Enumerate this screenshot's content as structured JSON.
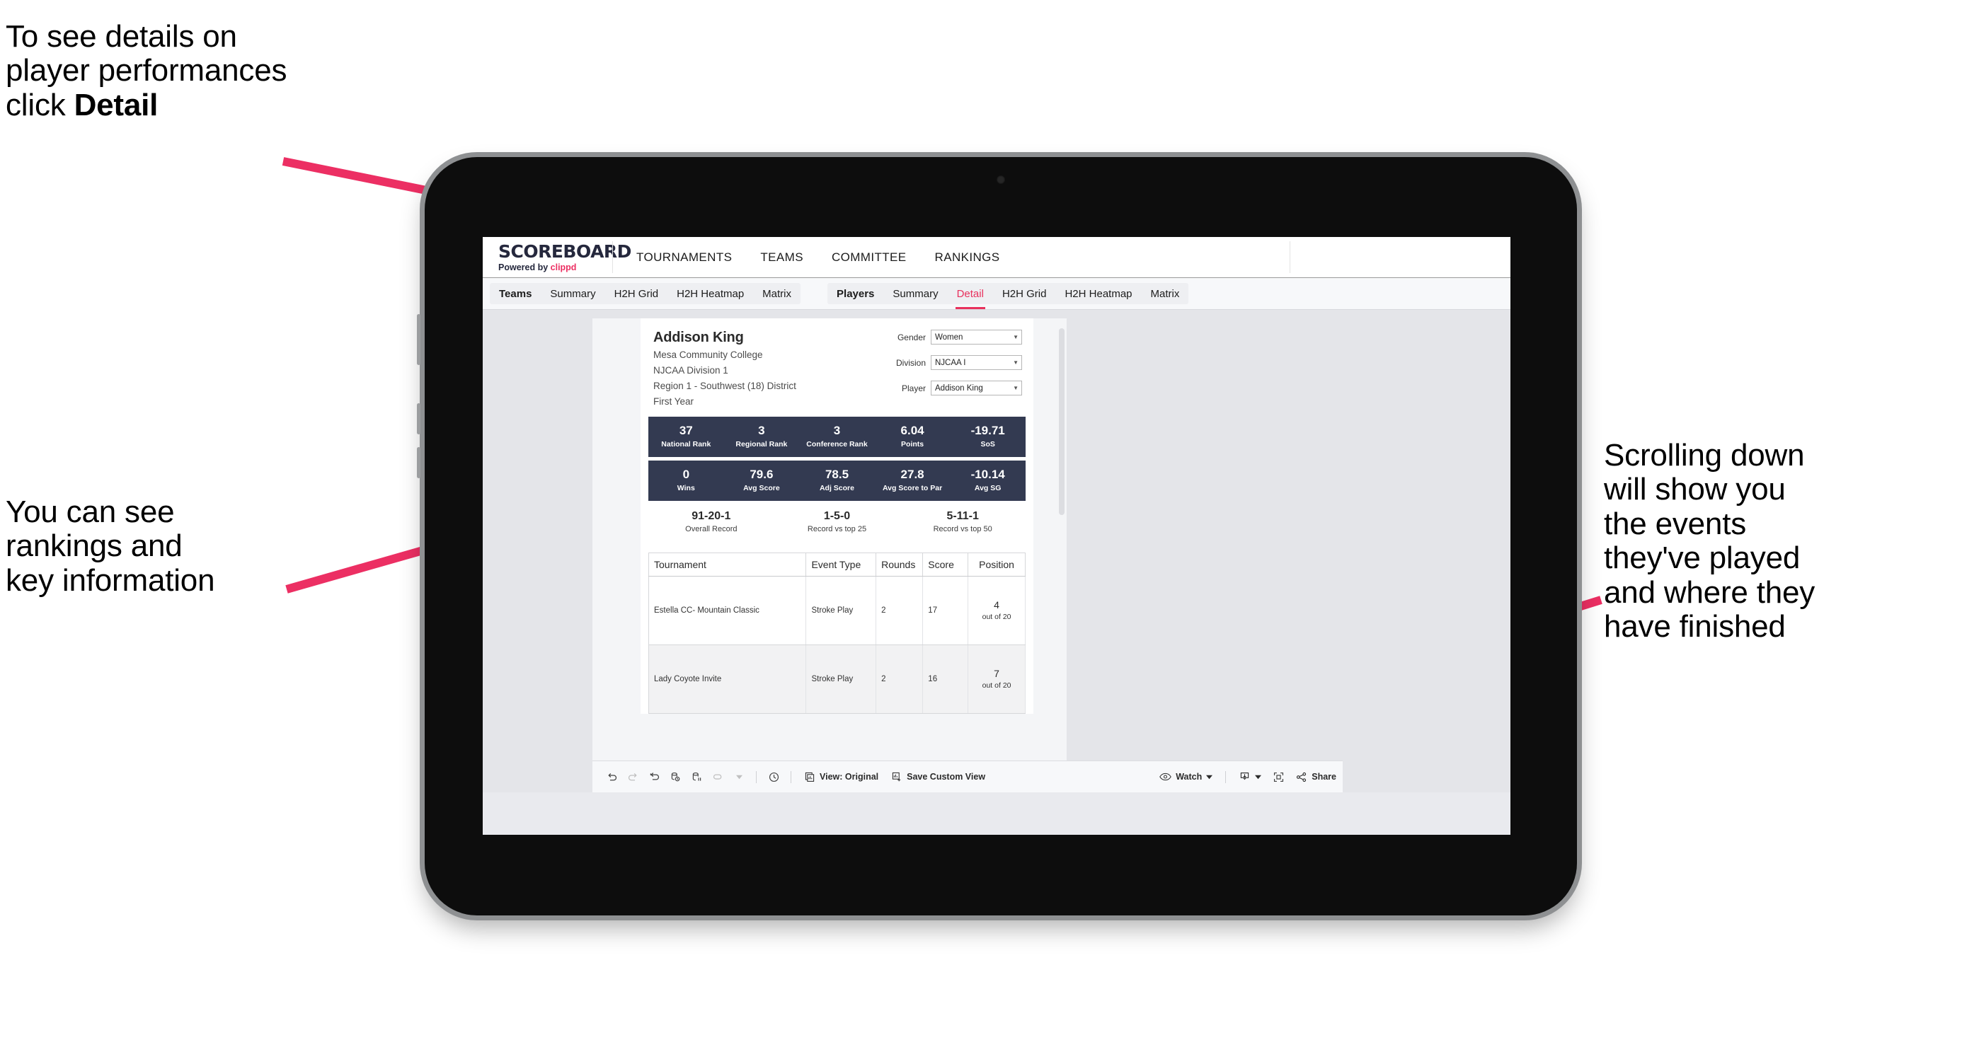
{
  "callouts": {
    "detail_line1": "To see details on\nplayer performances\nclick ",
    "detail_bold": "Detail",
    "rankings": "You can see\nrankings and\nkey information",
    "scrolling": "Scrolling down\nwill show you\nthe events\nthey've played\nand where they\nhave finished"
  },
  "app": {
    "brand": {
      "name": "SCOREBOARD",
      "powered_prefix": "Powered by ",
      "powered_accent": "clippd"
    },
    "top_nav": [
      "TOURNAMENTS",
      "TEAMS",
      "COMMITTEE",
      "RANKINGS"
    ],
    "tab_group_teams": [
      "Teams",
      "Summary",
      "H2H Grid",
      "H2H Heatmap",
      "Matrix"
    ],
    "tab_group_players": [
      "Players",
      "Summary",
      "Detail",
      "H2H Grid",
      "H2H Heatmap",
      "Matrix"
    ],
    "active_tab": "Detail"
  },
  "player": {
    "name": "Addison King",
    "college": "Mesa Community College",
    "division": "NJCAA Division 1",
    "region": "Region 1 - Southwest (18) District",
    "year": "First Year"
  },
  "filters": [
    {
      "label": "Gender",
      "value": "Women"
    },
    {
      "label": "Division",
      "value": "NJCAA I"
    },
    {
      "label": "Player",
      "value": "Addison King"
    }
  ],
  "stats_row_1": [
    {
      "value": "37",
      "label": "National Rank"
    },
    {
      "value": "3",
      "label": "Regional Rank"
    },
    {
      "value": "3",
      "label": "Conference Rank"
    },
    {
      "value": "6.04",
      "label": "Points"
    },
    {
      "value": "-19.71",
      "label": "SoS"
    }
  ],
  "stats_row_2": [
    {
      "value": "0",
      "label": "Wins"
    },
    {
      "value": "79.6",
      "label": "Avg Score"
    },
    {
      "value": "78.5",
      "label": "Adj Score"
    },
    {
      "value": "27.8",
      "label": "Avg Score to Par"
    },
    {
      "value": "-10.14",
      "label": "Avg SG"
    }
  ],
  "records": [
    {
      "value": "91-20-1",
      "label": "Overall Record"
    },
    {
      "value": "1-5-0",
      "label": "Record vs top 25"
    },
    {
      "value": "5-11-1",
      "label": "Record vs top 50"
    }
  ],
  "table": {
    "headers": [
      "Tournament",
      "Event Type",
      "Rounds",
      "Score",
      "Position"
    ],
    "rows": [
      {
        "tournament": "Estella CC- Mountain Classic",
        "event_type": "Stroke Play",
        "rounds": "2",
        "score": "17",
        "position": "4",
        "position_of": "out of 20"
      },
      {
        "tournament": "Lady Coyote Invite",
        "event_type": "Stroke Play",
        "rounds": "2",
        "score": "16",
        "position": "7",
        "position_of": "out of 20"
      }
    ]
  },
  "toolbar": {
    "view_label": "View: Original",
    "save_label": "Save Custom View",
    "watch_label": "Watch",
    "share_label": "Share"
  },
  "colors": {
    "accent_pink": "#e8315d",
    "statbar_navy": "#333a51",
    "arrow_pink": "#ec2f63"
  }
}
